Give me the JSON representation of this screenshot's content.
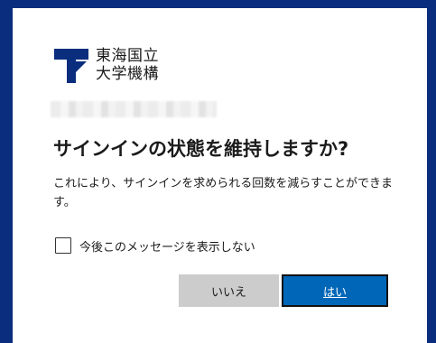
{
  "brand": {
    "logo_line1": "東海国立",
    "logo_line2": "大学機構",
    "logo_color": "#0a2e7d"
  },
  "dialog": {
    "title": "サインインの状態を維持しますか?",
    "description": "これにより、サインインを求められる回数を減らすことができます。",
    "checkbox_label": "今後このメッセージを表示しない",
    "checkbox_checked": false,
    "no_button": "いいえ",
    "yes_button": "はい"
  },
  "colors": {
    "background": "#0a2e7d",
    "primary_button": "#0067b8",
    "secondary_button": "#cccccc"
  }
}
